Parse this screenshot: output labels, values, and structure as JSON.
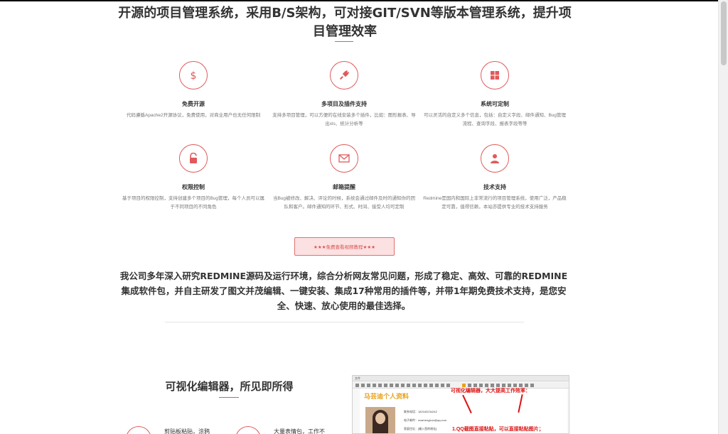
{
  "headline": "开源的项目管理系统，采用B/S架构，可对接GIT/SVN等版本管理系统，提升项目管理效率",
  "colors": {
    "accent": "#e05a5a",
    "cta_bg": "#fbe1e1",
    "cta_text": "#d9534f"
  },
  "features": [
    {
      "icon": "dollar-icon",
      "title": "免费开源",
      "desc": "代码遵循Apache2开源协议，免费使用，对商业用户也无任何限制"
    },
    {
      "icon": "plug-icon",
      "title": "多项目及插件支持",
      "desc": "支持多项目管理，可以方便的在线安装多个插件，比如：图形报表、导出xls、统计分析等"
    },
    {
      "icon": "grid-icon",
      "title": "系统可定制",
      "desc": "可以灵活的自定义多个信息，包括：自定义字段、邮件通知、Bug管理流程、查询字段、报表字段等等"
    },
    {
      "icon": "unlock-icon",
      "title": "权限控制",
      "desc": "基于项目的权限控制，支持创建多个项目的Bug管理，每个人员可以属于不同项目的不同角色"
    },
    {
      "icon": "envelope-icon",
      "title": "邮箱提醒",
      "desc": "当Bug被修改、解决、评论的时候，系统会通过邮件及时的通知你的团队和客户。邮件通知的环节、形式、时间、接受人均可定制"
    },
    {
      "icon": "user-icon",
      "title": "技术支持",
      "desc": "Redmine是国内和国际上非常流行的项目管理系统，使用广泛，产品稳定可靠，值得信赖，本站亦提供专业的技术支持服务"
    }
  ],
  "cta_label": "★★★免费查看视频教程★★★",
  "company_text": "我公司多年深入研究REDMINE源码及运行环境，综合分析网友常见问题，形成了稳定、高效、可靠的REDMINE集成软件包，并自主研发了图文并茂编辑、一键安装、集成17种常用的插件等，并带1年期免费技术支持，是您安全、快速、放心使用的最佳选择。",
  "editor": {
    "title": "可视化编辑器，所见即所得",
    "mini_features": [
      "剪贴板粘贴，涂鸦",
      "大量表情包，工作不"
    ],
    "screenshot": {
      "toolbar_label": "文件",
      "profile_title": "马芸迪个人资料",
      "info_lines": [
        "联系电话：18218323424Z",
        "电子邮件：mazhengkun@qq.com",
        "家庭住址：[输入您的地址]"
      ],
      "note_line1": "可视化编辑器，大大提高工作效率：",
      "note_line2": "1.QQ截图直接粘贴，可以直接粘贴图片；"
    }
  }
}
